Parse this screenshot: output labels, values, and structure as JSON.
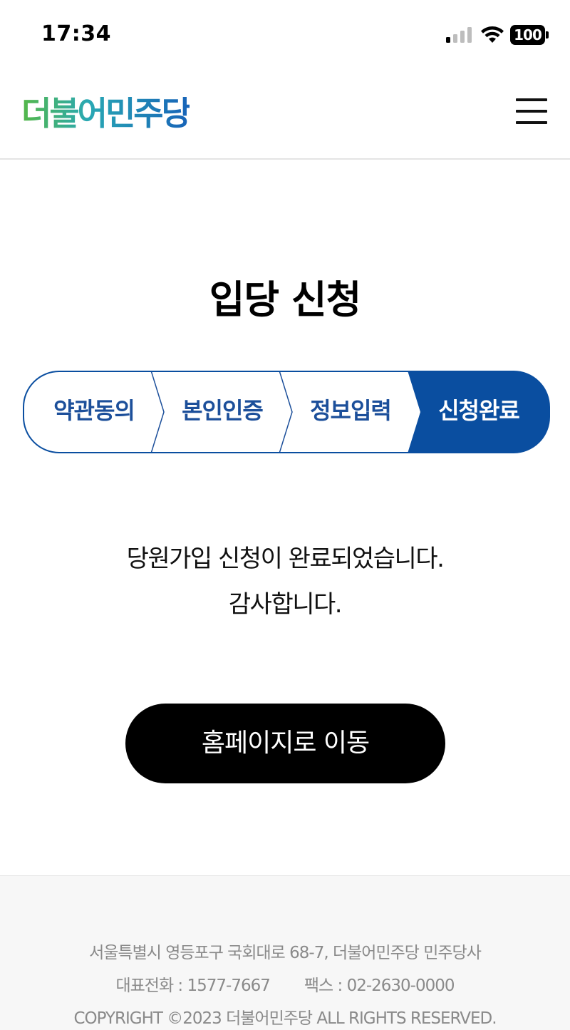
{
  "status_bar": {
    "time": "17:34",
    "battery": "100",
    "icons": [
      "signal-icon",
      "wifi-icon",
      "battery-icon"
    ]
  },
  "header": {
    "logo_text": "더불어민주당",
    "menu_icon": "hamburger-menu-icon"
  },
  "page": {
    "title": "입당 신청"
  },
  "steps": [
    {
      "label": "약관동의",
      "active": false
    },
    {
      "label": "본인인증",
      "active": false
    },
    {
      "label": "정보입력",
      "active": false
    },
    {
      "label": "신청완료",
      "active": true
    }
  ],
  "message": {
    "line1": "당원가입 신청이 완료되었습니다.",
    "line2": "감사합니다."
  },
  "home_button": {
    "label": "홈페이지로 이동"
  },
  "footer": {
    "address": "서울특별시 영등포구 국회대로 68-7, 더불어민주당 민주당사",
    "phone": "대표전화 : 1577-7667",
    "fax": "팩스 : 02-2630-0000",
    "copyright": "COPYRIGHT ©2023 더불어민주당 ALL RIGHTS RESERVED."
  },
  "colors": {
    "primary": "#0a4ea0",
    "step_text": "#1c4f9a",
    "button_bg": "#000000",
    "footer_bg": "#f7f7f7",
    "footer_text": "#8a8a8a"
  }
}
